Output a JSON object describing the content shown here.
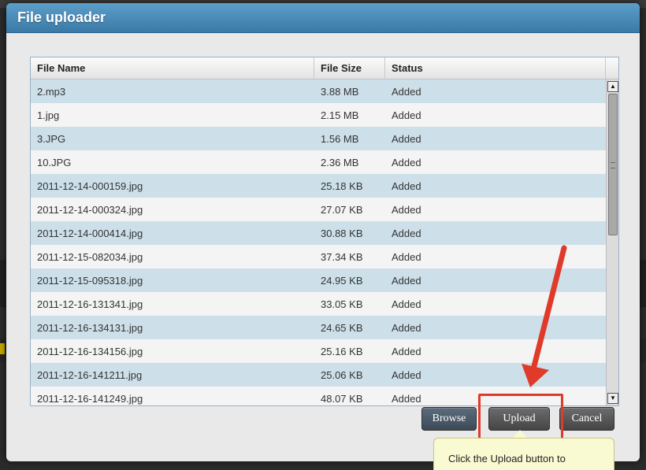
{
  "dialog": {
    "title": "File uploader"
  },
  "grid": {
    "columns": {
      "name": "File Name",
      "size": "File Size",
      "status": "Status"
    },
    "rows": [
      {
        "name": "2.mp3",
        "size": "3.88 MB",
        "status": "Added"
      },
      {
        "name": "1.jpg",
        "size": "2.15 MB",
        "status": "Added"
      },
      {
        "name": "3.JPG",
        "size": "1.56 MB",
        "status": "Added"
      },
      {
        "name": "10.JPG",
        "size": "2.36 MB",
        "status": "Added"
      },
      {
        "name": "2011-12-14-000159.jpg",
        "size": "25.18 KB",
        "status": "Added"
      },
      {
        "name": "2011-12-14-000324.jpg",
        "size": "27.07 KB",
        "status": "Added"
      },
      {
        "name": "2011-12-14-000414.jpg",
        "size": "30.88 KB",
        "status": "Added"
      },
      {
        "name": "2011-12-15-082034.jpg",
        "size": "37.34 KB",
        "status": "Added"
      },
      {
        "name": "2011-12-15-095318.jpg",
        "size": "24.95 KB",
        "status": "Added"
      },
      {
        "name": "2011-12-16-131341.jpg",
        "size": "33.05 KB",
        "status": "Added"
      },
      {
        "name": "2011-12-16-134131.jpg",
        "size": "24.65 KB",
        "status": "Added"
      },
      {
        "name": "2011-12-16-134156.jpg",
        "size": "25.16 KB",
        "status": "Added"
      },
      {
        "name": "2011-12-16-141211.jpg",
        "size": "25.06 KB",
        "status": "Added"
      },
      {
        "name": "2011-12-16-141249.jpg",
        "size": "48.07 KB",
        "status": "Added"
      }
    ]
  },
  "buttons": {
    "browse": "Browse",
    "upload": "Upload",
    "cancel": "Cancel"
  },
  "tooltip": {
    "text": "Click the Upload button to"
  },
  "icons": {
    "scroll_up": "triangle-up-icon",
    "scroll_down": "triangle-down-icon"
  },
  "colors": {
    "titlebar": "#3b79a7",
    "row_alt": "#cde0ea",
    "annotation": "#e03a2a",
    "tooltip_bg": "#fafad2"
  }
}
